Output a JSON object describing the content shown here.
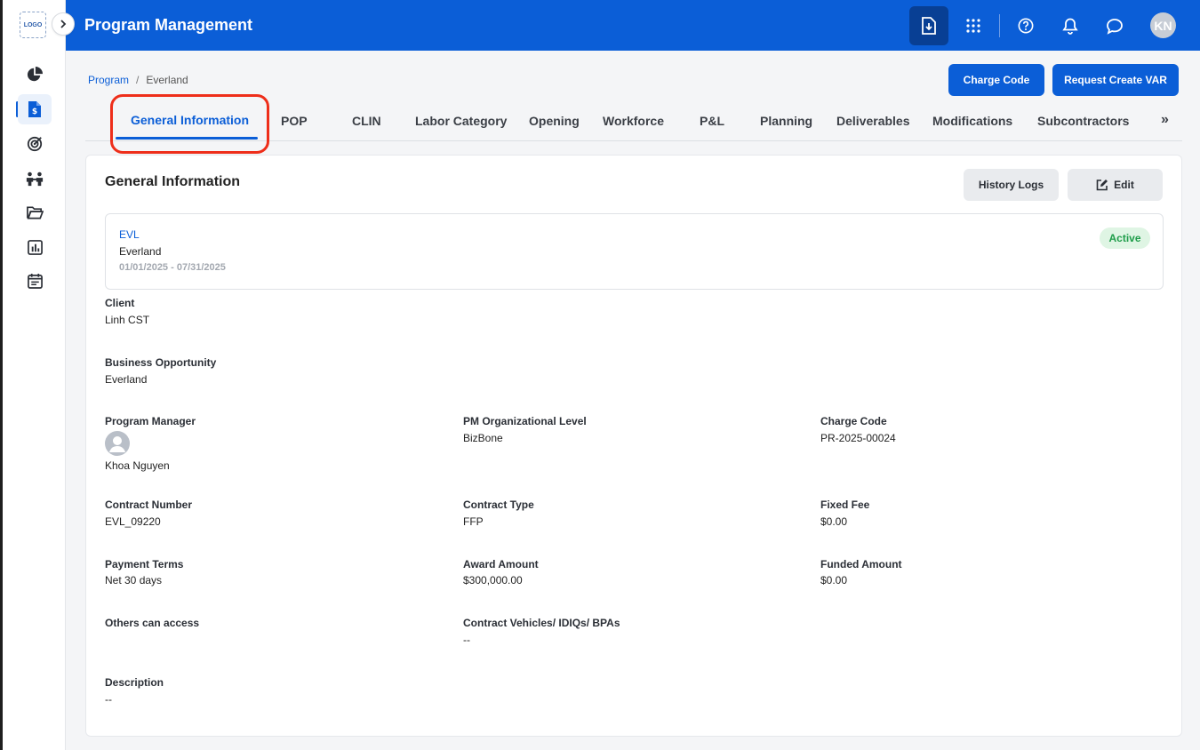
{
  "sidebar": {
    "logo_text": "LOGO",
    "items": [
      {
        "icon": "pie-chart-icon"
      },
      {
        "icon": "dollar-document-icon",
        "active": true
      },
      {
        "icon": "target-icon"
      },
      {
        "icon": "people-icon"
      },
      {
        "icon": "folder-open-icon"
      },
      {
        "icon": "bar-chart-icon"
      },
      {
        "icon": "calendar-icon"
      }
    ]
  },
  "header": {
    "title": "Program Management",
    "avatar_initials": "KN",
    "icons": [
      "download-document-icon",
      "apps-grid-icon",
      "help-icon",
      "bell-icon",
      "chat-icon"
    ]
  },
  "breadcrumb": {
    "root": "Program",
    "separator": "/",
    "current": "Everland"
  },
  "actions": {
    "charge_code": "Charge Code",
    "request_var": "Request Create VAR"
  },
  "tabs": [
    "General Information",
    "POP",
    "CLIN",
    "Labor Category",
    "Opening",
    "Workforce",
    "P&L",
    "Planning",
    "Deliverables",
    "Modifications",
    "Subcontractors"
  ],
  "tabs_more": "»",
  "card": {
    "title": "General Information",
    "history_logs": "History Logs",
    "edit": "Edit"
  },
  "summary": {
    "code": "EVL",
    "name": "Everland",
    "dates": "01/01/2025 - 07/31/2025",
    "status": "Active"
  },
  "fields": {
    "client": {
      "label": "Client",
      "value": "Linh CST"
    },
    "business_opportunity": {
      "label": "Business Opportunity",
      "value": "Everland"
    },
    "program_manager": {
      "label": "Program Manager",
      "value": "Khoa Nguyen"
    },
    "pm_org_level": {
      "label": "PM Organizational Level",
      "value": "BizBone"
    },
    "charge_code": {
      "label": "Charge Code",
      "value": "PR-2025-00024"
    },
    "contract_number": {
      "label": "Contract Number",
      "value": "EVL_09220"
    },
    "contract_type": {
      "label": "Contract Type",
      "value": "FFP"
    },
    "fixed_fee": {
      "label": "Fixed Fee",
      "value": "$0.00"
    },
    "payment_terms": {
      "label": "Payment Terms",
      "value": "Net 30 days"
    },
    "award_amount": {
      "label": "Award Amount",
      "value": "$300,000.00"
    },
    "funded_amount": {
      "label": "Funded Amount",
      "value": "$0.00"
    },
    "others_can_access": {
      "label": "Others can access",
      "value": ""
    },
    "contract_vehicles": {
      "label": "Contract Vehicles/ IDIQs/ BPAs",
      "value": "--"
    },
    "description": {
      "label": "Description",
      "value": "--"
    }
  },
  "colors": {
    "primary": "#0b5ed7",
    "highlight": "#ee2e1a",
    "active_badge_bg": "#dff5e4",
    "active_badge_text": "#1f9d4a"
  }
}
